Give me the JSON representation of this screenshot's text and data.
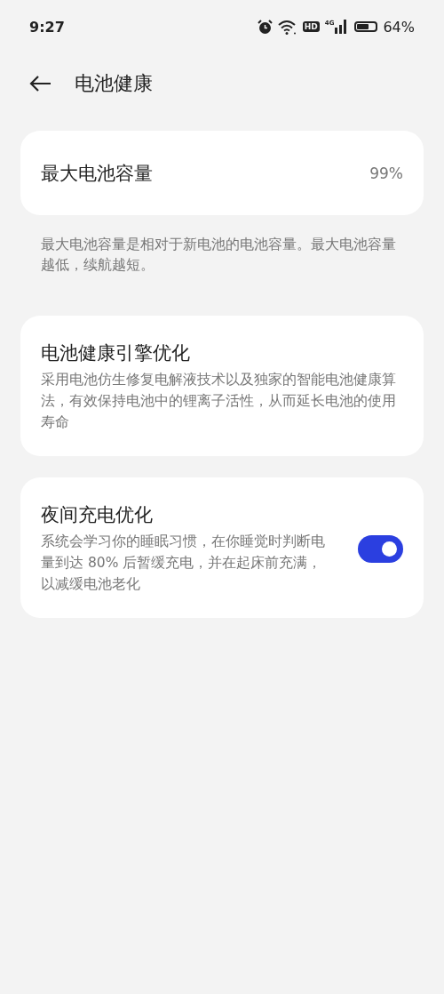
{
  "status_bar": {
    "time": "9:27",
    "hd_badge": "HD",
    "network": "4G",
    "battery": "64%"
  },
  "header": {
    "title": "电池健康"
  },
  "items": [
    {
      "kind": "value",
      "title": "最大电池容量",
      "value": "99%",
      "footnote": "最大电池容量是相对于新电池的电池容量。最大电池容量越低，续航越短。"
    },
    {
      "kind": "info",
      "title": "电池健康引擎优化",
      "description": "采用电池仿生修复电解液技术以及独家的智能电池健康算法，有效保持电池中的锂离子活性，从而延长电池的使用寿命"
    },
    {
      "kind": "toggle",
      "title": "夜间充电优化",
      "description": "系统会学习你的睡眠习惯，在你睡觉时判断电量到达 80% 后暂缓充电，并在起床前充满，以减缓电池老化",
      "on": true
    }
  ]
}
